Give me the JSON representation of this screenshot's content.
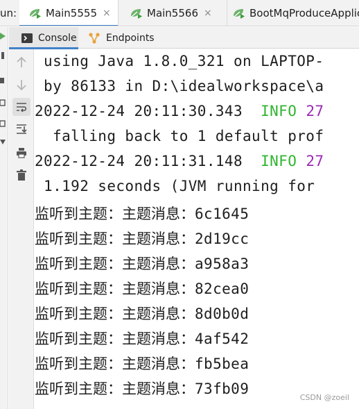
{
  "run_panel": {
    "label": "un:",
    "tabs": [
      {
        "label": "Main5555",
        "active": true
      },
      {
        "label": "Main5566",
        "active": false
      },
      {
        "label": "BootMqProduceApplic",
        "active": false
      }
    ],
    "close_glyph": "×"
  },
  "subtabs": {
    "console": "Console",
    "endpoints": "Endpoints"
  },
  "toolbar_icons": [
    "up-arrow-icon",
    "down-arrow-icon",
    "soft-wrap-icon",
    "scroll-to-end-icon",
    "print-icon",
    "trash-icon"
  ],
  "console": {
    "lines": [
      {
        "text": " using Java 1.8.0_321 on LAPTOP-"
      },
      {
        "text": " by 86133 in D:\\idealworkspace\\a"
      },
      {
        "timestamp": "2022-12-24 20:11:30.343",
        "level": "INFO",
        "pid": "27"
      },
      {
        "text": "  falling back to 1 default prof"
      },
      {
        "timestamp": "2022-12-24 20:11:31.148",
        "level": "INFO",
        "pid": "27"
      },
      {
        "text": " 1.192 seconds (JVM running for "
      }
    ],
    "messages": [
      {
        "prefix": "监听到主题：主题消息：",
        "value": "6c1645"
      },
      {
        "prefix": "监听到主题：主题消息：",
        "value": "2d19cc"
      },
      {
        "prefix": "监听到主题：主题消息：",
        "value": "a958a3"
      },
      {
        "prefix": "监听到主题：主题消息：",
        "value": "82cea0"
      },
      {
        "prefix": "监听到主题：主题消息：",
        "value": "8d0b0d"
      },
      {
        "prefix": "监听到主题：主题消息：",
        "value": "4af542"
      },
      {
        "prefix": "监听到主题：主题消息：",
        "value": "fb5bea"
      },
      {
        "prefix": "监听到主题：主题消息：",
        "value": "73fb09"
      }
    ]
  },
  "colors": {
    "info": "#2fb52f",
    "pid": "#9b2ab3",
    "accent": "#4083c9",
    "run_icon": "#5aa85a"
  },
  "watermark": "CSDN @zoeil"
}
